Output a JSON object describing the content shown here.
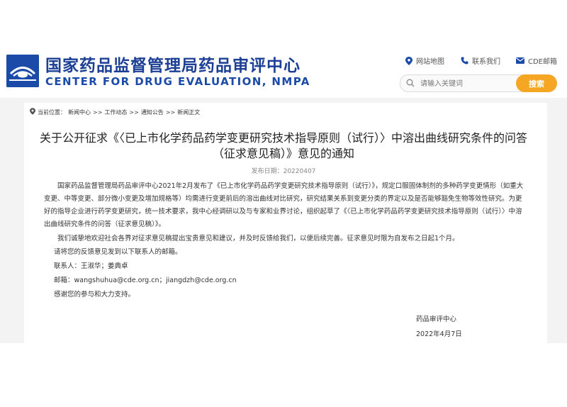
{
  "header": {
    "title_cn": "国家药品监督管理局药品审评中心",
    "title_en": "CENTER FOR DRUG EVALUATION, NMPA",
    "links": [
      {
        "label": "网站地图",
        "icon": "location-pin-icon"
      },
      {
        "label": "联系我们",
        "icon": "phone-icon"
      },
      {
        "label": "CDE邮箱",
        "icon": "mail-icon"
      }
    ],
    "search": {
      "placeholder": "请输入关键词",
      "button_label": "搜索"
    }
  },
  "breadcrumb": {
    "prefix": "当前位置：",
    "items": [
      "新闻中心",
      "工作动态",
      "通知公告",
      "新闻正文"
    ],
    "separator": ">>"
  },
  "article": {
    "title_line1": "关于公开征求《〈已上市化学药品药学变更研究技术指导原则（试行）〉中溶出曲线研究条件的问答",
    "title_line2": "（征求意见稿）》意见的通知",
    "pub_label": "发布日期：",
    "pub_date": "20220407",
    "paragraph1": "国家药品监督管理局药品审评中心2021年2月发布了《已上市化学药品药学变更研究技术指导原则（试行）》，规定口服固体制剂的多种药学变更情形（如重大变更、中等变更、部分微小变更及增加规格等）均需进行变更前后的溶出曲线对比研究，研究结果关系到变更分类的界定以及是否能够豁免生物等效性研究。为更好的指导企业进行药学变更研究，统一技术要求，我中心经调研以及与专家和业界讨论，组织起草了《〈已上市化学药品药学变更研究技术指导原则（试行）〉中溶出曲线研究条件的问答（征求意见稿）》。",
    "paragraph2": "我们诚挚地欢迎社会各界对征求意见稿提出宝贵意见和建议，并及时反馈给我们，以便后续完善。征求意见时限为自发布之日起1个月。",
    "line3": "请将您的反馈意见发到以下联系人的邮箱。",
    "contact": "联系人：王淑华；姜典卓",
    "email_label": "邮箱：",
    "email1": "wangshuhua@cde.org.cn",
    "email_sep": "；",
    "email2": "jiangdzh@cde.org.cn",
    "thanks": "感谢您的参与和大力支持。",
    "signature_org": "药品审评中心",
    "signature_date": "2022年4月7日"
  },
  "colors": {
    "brand_blue": "#1c3f95",
    "search_button": "#f5a623",
    "content_background": "#f3f3f3"
  }
}
